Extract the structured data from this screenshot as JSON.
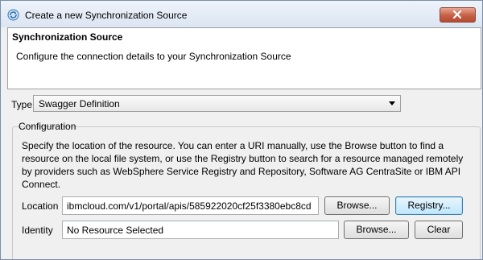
{
  "window": {
    "title": "Create a new Synchronization Source"
  },
  "header": {
    "title": "Synchronization Source",
    "description": "Configure the connection details to your Synchronization Source"
  },
  "type_field": {
    "label": "Type",
    "selected": "Swagger Definition"
  },
  "configuration": {
    "group_label": "Configuration",
    "description": "Specify the location of the resource.  You can enter a URI manually, use the Browse button to find a resource on the local file system, or use the Registry button to search for a resource managed remotely by providers such as WebSphere Service Registry and Repository, Software AG CentraSite or IBM API Connect.",
    "location": {
      "label": "Location",
      "value": "ibmcloud.com/v1/portal/apis/585922020cf25f3380ebc8cd",
      "browse_label": "Browse...",
      "registry_label": "Registry..."
    },
    "identity": {
      "label": "Identity",
      "value": "No Resource Selected",
      "browse_label": "Browse...",
      "clear_label": "Clear"
    }
  }
}
